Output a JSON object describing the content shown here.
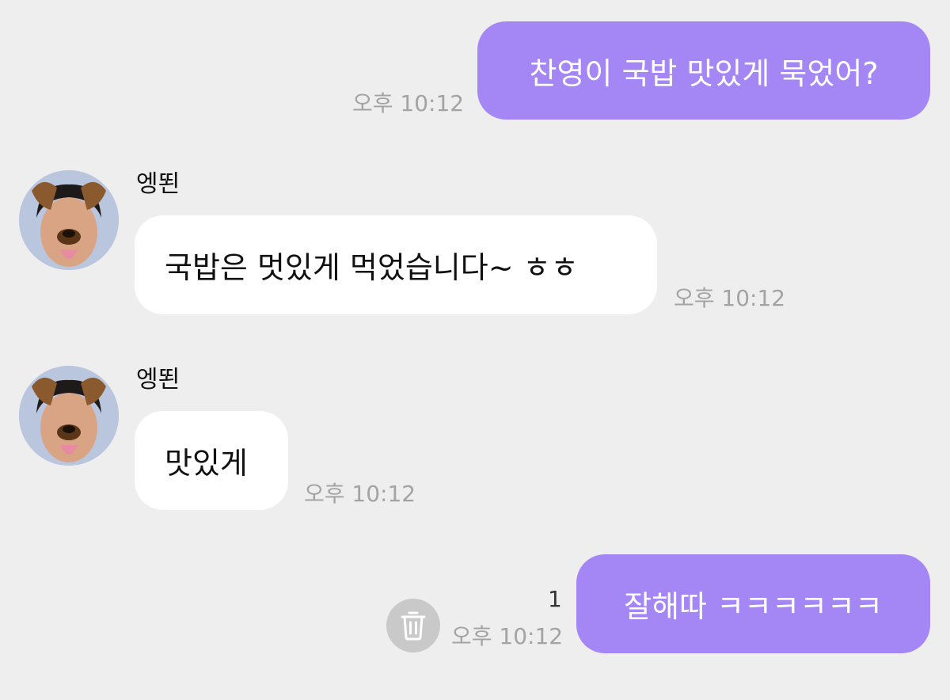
{
  "messages": [
    {
      "direction": "outgoing",
      "text": "찬영이 국밥 맛있게 묵었어?",
      "time": "오후 10:12"
    },
    {
      "direction": "incoming",
      "sender": "엥뙨",
      "text": "국밥은 멋있게 먹었습니다~ ㅎㅎ",
      "time": "오후 10:12"
    },
    {
      "direction": "incoming",
      "sender": "엥뙨",
      "text": "맛있게",
      "time": "오후 10:12"
    },
    {
      "direction": "outgoing",
      "text": "잘해따 ㅋㅋㅋㅋㅋㅋ",
      "time": "오후 10:12",
      "unread_count": "1"
    }
  ],
  "icons": {
    "avatar": "profile-photo-dog-filter",
    "delete": "trash-icon"
  },
  "colors": {
    "background": "#eeeeee",
    "outgoing_bubble": "#a586f5",
    "incoming_bubble": "#ffffff",
    "timestamp": "#a3a3a3",
    "delete_button": "#c9c9c9"
  }
}
